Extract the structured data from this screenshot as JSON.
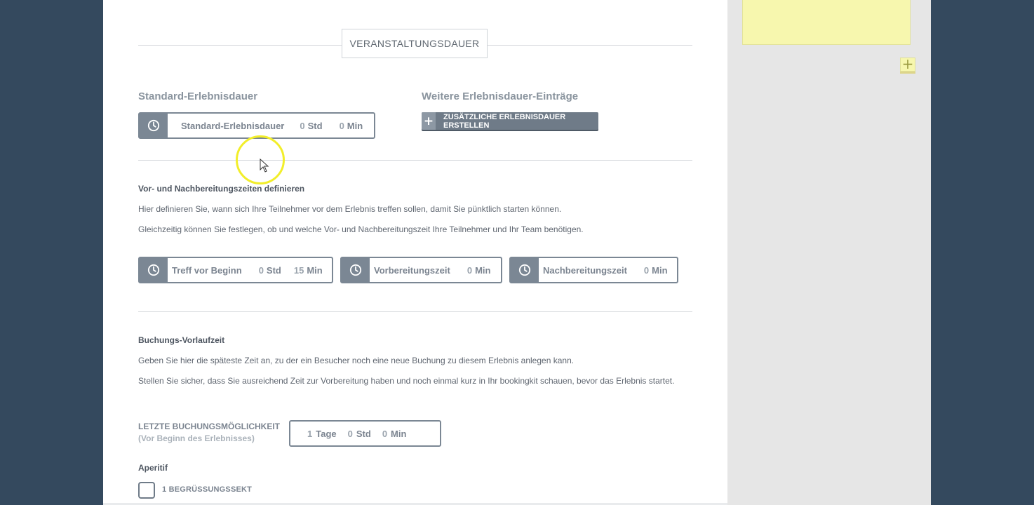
{
  "section": {
    "title": "VERANSTALTUNGSDAUER"
  },
  "standard": {
    "heading": "Standard-Erlebnisdauer",
    "box": {
      "label": "Standard-Erlebnisdauer",
      "std_value": "0",
      "std_unit": "Std",
      "min_value": "0",
      "min_unit": "Min"
    }
  },
  "weitere": {
    "heading": "Weitere Erlebnisdauer-Einträge",
    "button_label": "ZUSÄTZLICHE ERLEBNISDAUER ERSTELLEN"
  },
  "prep": {
    "heading": "Vor- und Nachbereitungszeiten definieren",
    "text1": "Hier definieren Sie, wann sich Ihre Teilnehmer vor dem Erlebnis treffen sollen, damit Sie pünktlich starten können.",
    "text2": "Gleichzeitig können Sie festlegen, ob und welche Vor- und Nachbereitungszeit Ihre Teilnehmer und Ihr Team benötigen.",
    "treff": {
      "label": "Treff vor Beginn",
      "std_value": "0",
      "std_unit": "Std",
      "min_value": "15",
      "min_unit": "Min"
    },
    "vor": {
      "label": "Vorbereitungszeit",
      "min_value": "0",
      "min_unit": "Min"
    },
    "nach": {
      "label": "Nachbereitungszeit",
      "min_value": "0",
      "min_unit": "Min"
    }
  },
  "booking": {
    "heading": "Buchungs-Vorlaufzeit",
    "text1": "Geben Sie hier die späteste Zeit an, zu der ein Besucher noch eine neue Buchung zu diesem Erlebnis anlegen kann.",
    "text2": "Stellen Sie sicher, dass Sie ausreichend Zeit zur Vorbereitung haben und noch einmal kurz in Ihr bookingkit schauen, bevor das Erlebnis startet.",
    "last_label": "LETZTE BUCHUNGSMÖGLICHKEIT",
    "last_sub": "(Vor Beginn des Erlebnisses)",
    "tage_value": "1",
    "tage_unit": "Tage",
    "std_value": "0",
    "std_unit": "Std",
    "min_value": "0",
    "min_unit": "Min"
  },
  "aperitif": {
    "heading": "Aperitif",
    "option_label": "1 BEGRÜSSUNGSSEKT"
  },
  "sidebar": {
    "add_note": "+"
  },
  "colors": {
    "background": "#34495e",
    "box": "#7b8794",
    "note": "#f7f7ae",
    "cursor_ring": "#f2ee2a"
  }
}
